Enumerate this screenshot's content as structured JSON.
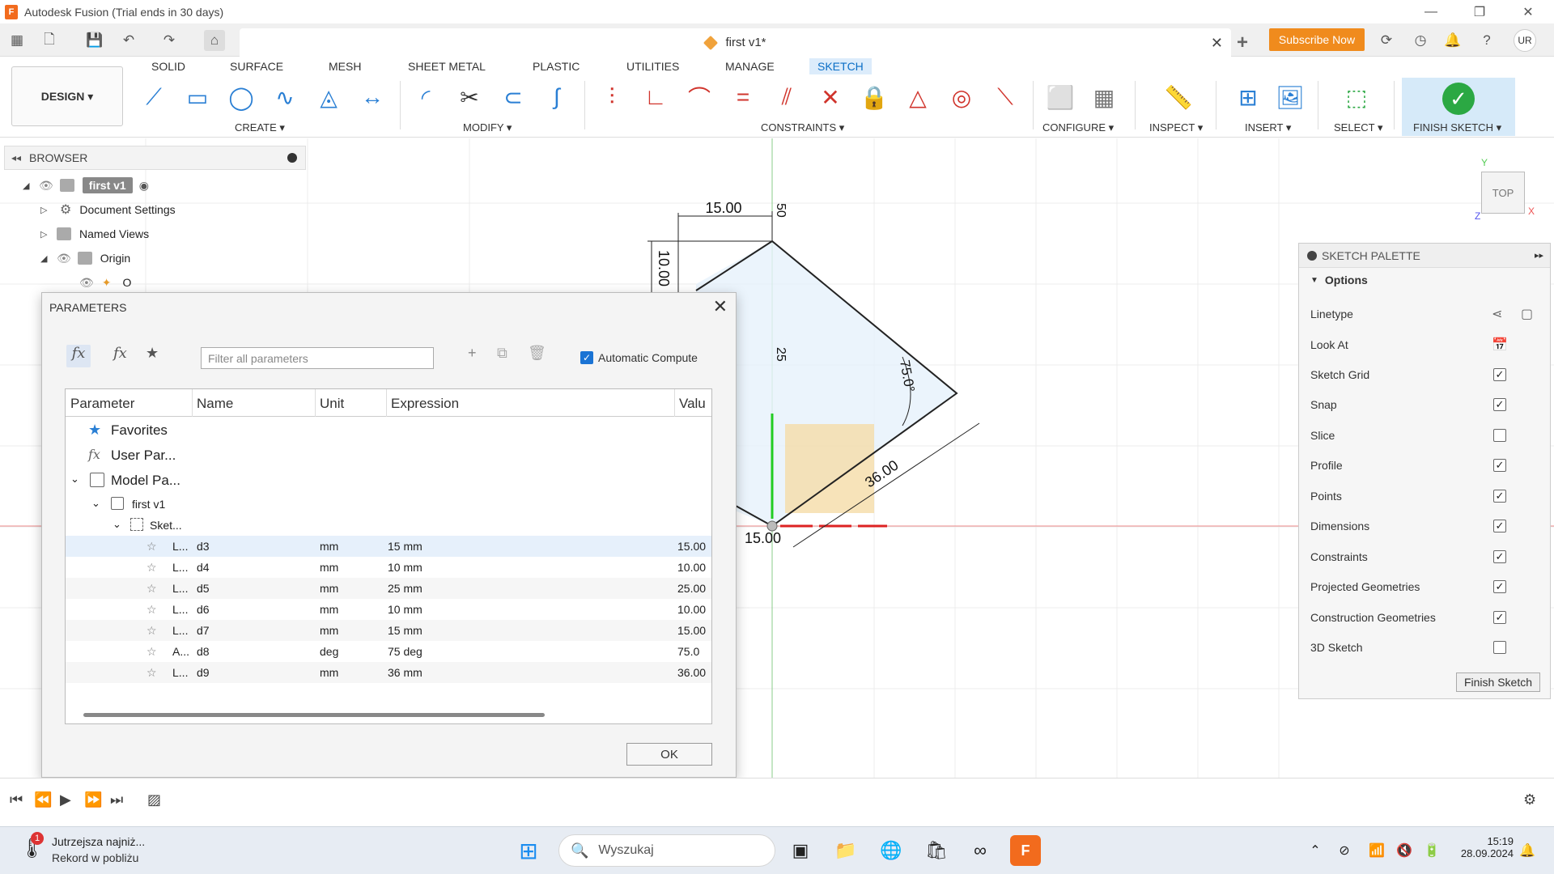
{
  "window": {
    "title": "Autodesk Fusion (Trial ends in 30 days)",
    "logo_letter": "F",
    "minimize": "—",
    "maximize": "❐",
    "close": "✕"
  },
  "tabbar": {
    "document_title": "first v1*",
    "close": "✕",
    "new_tab": "+",
    "subscribe_label": "Subscribe Now",
    "user_initials": "UR"
  },
  "ribbon": {
    "workspace": "DESIGN ▾",
    "tabs": [
      "SOLID",
      "SURFACE",
      "MESH",
      "SHEET METAL",
      "PLASTIC",
      "UTILITIES",
      "MANAGE",
      "SKETCH"
    ],
    "active_tab": "SKETCH",
    "groups": {
      "create": "CREATE ▾",
      "modify": "MODIFY ▾",
      "constraints": "CONSTRAINTS ▾",
      "configure": "CONFIGURE ▾",
      "inspect": "INSPECT ▾",
      "insert": "INSERT ▾",
      "select": "SELECT ▾",
      "finish": "FINISH SKETCH ▾"
    }
  },
  "browser": {
    "header": "BROWSER",
    "root": "first v1",
    "items": [
      "Document Settings",
      "Named Views",
      "Origin",
      "O"
    ]
  },
  "sketch": {
    "dim_top": "15.00",
    "dim_vertical_50": "50",
    "dim_left": "10.00",
    "dim_25": "25",
    "dim_angle": "75.0°",
    "dim_36": "36.00",
    "dim_bottom": "15.00"
  },
  "viewcube": {
    "label": "TOP",
    "axis_x": "X",
    "axis_y": "Y",
    "axis_z": "Z"
  },
  "palette": {
    "header": "SKETCH PALETTE",
    "section": "Options",
    "rows": [
      {
        "label": "Linetype",
        "type": "icon"
      },
      {
        "label": "Look At",
        "type": "icon"
      },
      {
        "label": "Sketch Grid",
        "checked": true
      },
      {
        "label": "Snap",
        "checked": true
      },
      {
        "label": "Slice",
        "checked": false
      },
      {
        "label": "Profile",
        "checked": true
      },
      {
        "label": "Points",
        "checked": true
      },
      {
        "label": "Dimensions",
        "checked": true
      },
      {
        "label": "Constraints",
        "checked": true
      },
      {
        "label": "Projected Geometries",
        "checked": true
      },
      {
        "label": "Construction Geometries",
        "checked": true
      },
      {
        "label": "3D Sketch",
        "checked": false
      }
    ],
    "finish_button": "Finish Sketch"
  },
  "dialog": {
    "title": "PARAMETERS",
    "filter_placeholder": "Filter all parameters",
    "auto_compute": "Automatic Compute",
    "columns": [
      "Parameter",
      "Name",
      "Unit",
      "Expression",
      "Valu"
    ],
    "groups": {
      "favorites": "Favorites",
      "user": "User Par...",
      "model": "Model Pa...",
      "component": "first v1",
      "sketch": "Sket..."
    },
    "rows": [
      {
        "param": "L...",
        "name": "d3",
        "unit": "mm",
        "expr": "15 mm",
        "value": "15.00"
      },
      {
        "param": "L...",
        "name": "d4",
        "unit": "mm",
        "expr": "10 mm",
        "value": "10.00"
      },
      {
        "param": "L...",
        "name": "d5",
        "unit": "mm",
        "expr": "25 mm",
        "value": "25.00"
      },
      {
        "param": "L...",
        "name": "d6",
        "unit": "mm",
        "expr": "10 mm",
        "value": "10.00"
      },
      {
        "param": "L...",
        "name": "d7",
        "unit": "mm",
        "expr": "15 mm",
        "value": "15.00"
      },
      {
        "param": "A...",
        "name": "d8",
        "unit": "deg",
        "expr": "75 deg",
        "value": "75.0"
      },
      {
        "param": "L...",
        "name": "d9",
        "unit": "mm",
        "expr": "36 mm",
        "value": "36.00"
      }
    ],
    "ok": "OK"
  },
  "taskbar": {
    "weather_line1": "Jutrzejsza najniż...",
    "weather_line2": "Rekord w pobliżu",
    "weather_badge": "1",
    "search_placeholder": "Wyszukaj",
    "time": "15:19",
    "date": "28.09.2024"
  },
  "colors": {
    "accent": "#0a6ec6",
    "subscribe": "#f08b1d",
    "finish_green": "#2ba843"
  }
}
